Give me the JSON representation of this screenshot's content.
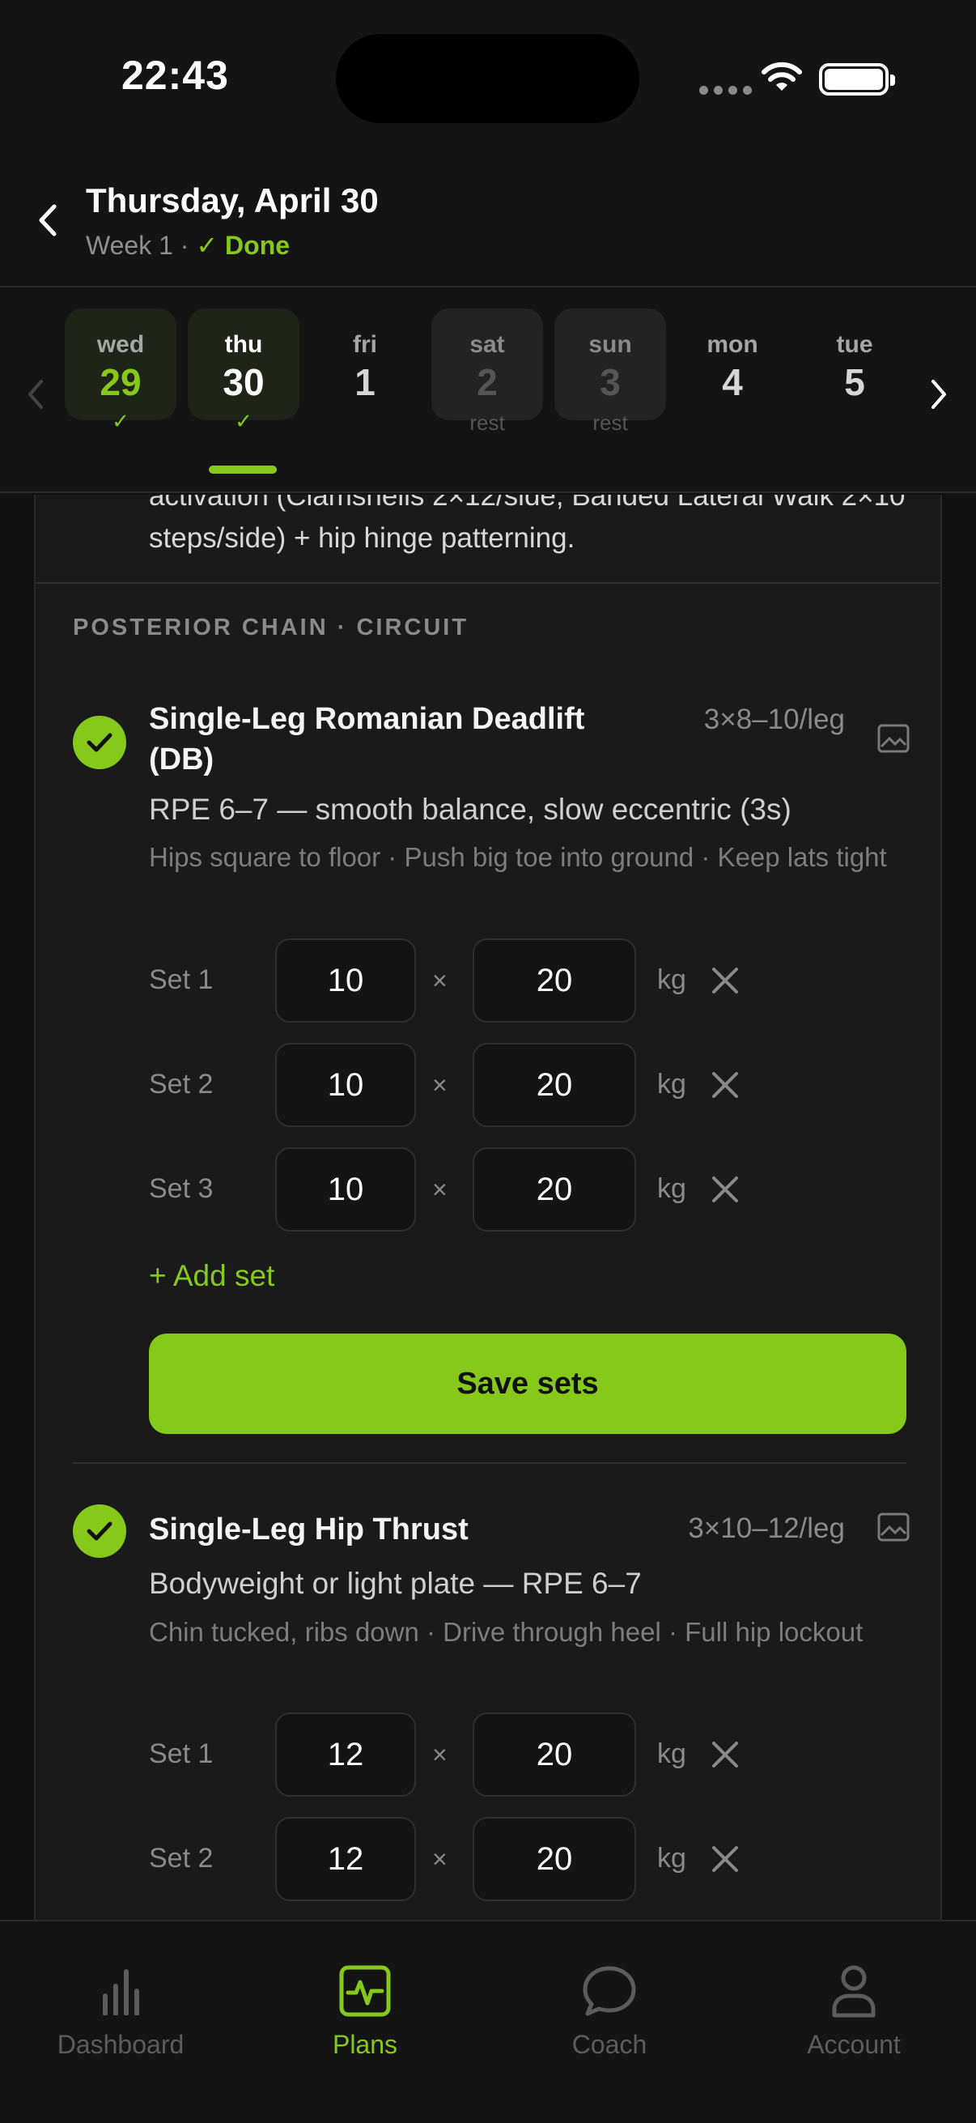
{
  "status_bar": {
    "time": "22:43"
  },
  "header": {
    "title": "Thursday, April 30",
    "week": "Week 1",
    "separator": " · ",
    "done_label": "✓ Done"
  },
  "day_strip": {
    "days": [
      {
        "name": "wed",
        "num": "29",
        "mark": "✓",
        "state": "done"
      },
      {
        "name": "thu",
        "num": "30",
        "mark": "✓",
        "state": "selected"
      },
      {
        "name": "fri",
        "num": "1",
        "state": "plain"
      },
      {
        "name": "sat",
        "num": "2",
        "sub": "rest",
        "state": "rest"
      },
      {
        "name": "sun",
        "num": "3",
        "sub": "rest",
        "state": "rest"
      },
      {
        "name": "mon",
        "num": "4",
        "state": "plain"
      },
      {
        "name": "tue",
        "num": "5",
        "state": "plain"
      }
    ]
  },
  "content": {
    "prev_text": "activation (Clamshells 2×12/side, Banded Lateral Walk 2×10 steps/side) + hip hinge patterning.",
    "section_label": "POSTERIOR CHAIN · CIRCUIT",
    "exercises": [
      {
        "name": "Single-Leg Romanian Deadlift (DB)",
        "scheme": "3×8–10/leg",
        "rpe": "RPE 6–7 — smooth balance, slow eccentric (3s)",
        "cues": "Hips square to floor · Push big toe into ground · Keep lats tight",
        "sets": [
          {
            "label": "Set 1",
            "reps": "10",
            "weight": "20",
            "unit": "kg"
          },
          {
            "label": "Set 2",
            "reps": "10",
            "weight": "20",
            "unit": "kg"
          },
          {
            "label": "Set 3",
            "reps": "10",
            "weight": "20",
            "unit": "kg"
          }
        ],
        "add_set_label": "+ Add set",
        "save_label": "Save sets"
      },
      {
        "name": "Single-Leg Hip Thrust",
        "scheme": "3×10–12/leg",
        "rpe": "Bodyweight or light plate — RPE 6–7",
        "cues": "Chin tucked, ribs down · Drive through heel · Full hip lockout",
        "sets": [
          {
            "label": "Set 1",
            "reps": "12",
            "weight": "20",
            "unit": "kg"
          },
          {
            "label": "Set 2",
            "reps": "12",
            "weight": "20",
            "unit": "kg"
          }
        ]
      }
    ],
    "times_symbol": "×"
  },
  "tab_bar": {
    "tabs": [
      {
        "label": "Dashboard",
        "icon": "bar-chart-icon"
      },
      {
        "label": "Plans",
        "icon": "activity-icon",
        "active": true
      },
      {
        "label": "Coach",
        "icon": "chat-bubble-icon"
      },
      {
        "label": "Account",
        "icon": "person-icon"
      }
    ]
  },
  "colors": {
    "accent": "#86c91b",
    "background": "#111111",
    "card": "#1a1a1a"
  }
}
